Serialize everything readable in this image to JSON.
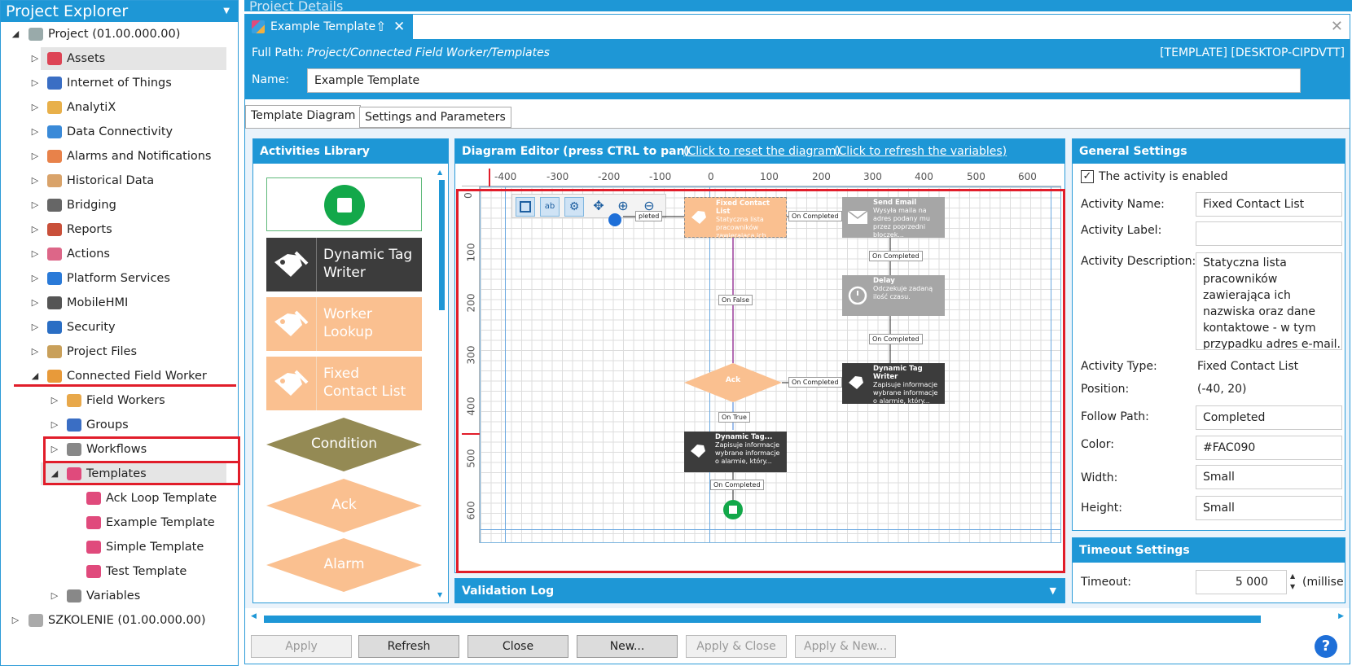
{
  "explorer": {
    "title": "Project Explorer",
    "items": [
      {
        "label": "Project (01.00.000.00)",
        "icon": "project-icon",
        "expanded": true
      },
      {
        "label": "Assets",
        "icon": "assets-icon"
      },
      {
        "label": "Internet of Things",
        "icon": "iot-icon"
      },
      {
        "label": "AnalytiX",
        "icon": "analytix-icon"
      },
      {
        "label": "Data Connectivity",
        "icon": "data-connectivity-icon"
      },
      {
        "label": "Alarms and Notifications",
        "icon": "alarm-icon"
      },
      {
        "label": "Historical Data",
        "icon": "historical-data-icon"
      },
      {
        "label": "Bridging",
        "icon": "bridging-icon"
      },
      {
        "label": "Reports",
        "icon": "reports-icon"
      },
      {
        "label": "Actions",
        "icon": "actions-icon"
      },
      {
        "label": "Platform Services",
        "icon": "platform-services-icon"
      },
      {
        "label": "MobileHMI",
        "icon": "mobilehmi-icon"
      },
      {
        "label": "Security",
        "icon": "security-icon"
      },
      {
        "label": "Project Files",
        "icon": "project-files-icon"
      },
      {
        "label": "Connected Field Worker",
        "icon": "connected-field-worker-icon"
      },
      {
        "label": "Field Workers",
        "icon": "field-workers-icon"
      },
      {
        "label": "Groups",
        "icon": "groups-icon"
      },
      {
        "label": "Workflows",
        "icon": "workflows-icon"
      },
      {
        "label": "Templates",
        "icon": "templates-icon"
      },
      {
        "label": "Ack Loop Template",
        "icon": "template-icon"
      },
      {
        "label": "Example Template",
        "icon": "template-icon"
      },
      {
        "label": "Simple Template",
        "icon": "template-icon"
      },
      {
        "label": "Test Template",
        "icon": "template-icon"
      },
      {
        "label": "Variables",
        "icon": "variables-icon"
      },
      {
        "label": "SZKOLENIE (01.00.000.00)",
        "icon": "project-icon"
      }
    ]
  },
  "details": {
    "panel_title": "Project Details",
    "tab_title": "Example Template",
    "full_path_label": "Full Path:",
    "full_path_value": "Project/Connected Field Worker/Templates",
    "server_tag": "[TEMPLATE] [DESKTOP-CIPDVTT]",
    "name_label": "Name:",
    "name_value": "Example Template",
    "subtabs": [
      "Template Diagram",
      "Settings and Parameters"
    ]
  },
  "library": {
    "title": "Activities Library",
    "items": [
      "Dynamic Tag Writer",
      "Worker Lookup",
      "Fixed Contact List",
      "Condition",
      "Ack",
      "Alarm"
    ]
  },
  "diagram": {
    "title": "Diagram Editor (press CTRL to pan)",
    "reset_link": "(Click to reset the diagram)",
    "refresh_link": "(Click to refresh the variables)",
    "ruler_x": [
      "-400",
      "-300",
      "-200",
      "-100",
      "0",
      "100",
      "200",
      "300",
      "400",
      "500",
      "600"
    ],
    "ruler_y": [
      "0",
      "100",
      "200",
      "300",
      "400",
      "500",
      "600"
    ],
    "nodes": {
      "fixed_contact": {
        "title": "Fixed Contact List",
        "desc": "Statyczna lista pracowników zawierająca ich..."
      },
      "send_email": {
        "title": "Send Email",
        "desc": "Wysyła maila na adres podany mu przez poprzedni bloczek..."
      },
      "delay": {
        "title": "Delay",
        "desc": "Odczekuje zadaną ilość czasu."
      },
      "dtw_right": {
        "title": "Dynamic Tag Writer",
        "desc": "Zapisuje informacje wybrane informacje o alarmie, który..."
      },
      "dtw_bottom": {
        "title": "Dynamic Tag...",
        "desc": "Zapisuje informacje wybrane informacje o alarmie, który..."
      },
      "ack": {
        "title": "Ack"
      }
    },
    "connectors": {
      "c1": "pleted",
      "c2": "On Completed",
      "c3": "On Completed",
      "c4": "On False",
      "c5": "On Completed",
      "c6": "On Completed",
      "c7": "On True",
      "c8": "On Completed"
    }
  },
  "validation": {
    "title": "Validation Log"
  },
  "general": {
    "title": "General Settings",
    "enabled_label": "The activity is enabled",
    "activity_name_label": "Activity Name:",
    "activity_name_value": "Fixed Contact List",
    "activity_label_label": "Activity Label:",
    "activity_label_value": "",
    "activity_desc_label": "Activity Description:",
    "activity_desc_value": "Statyczna lista pracowników zawierająca ich nazwiska oraz dane kontaktowe - w tym przypadku adres e-mail. Przy każdym obiegu pętli bloczek ten udostępnia na swoim",
    "activity_type_label": "Activity Type:",
    "activity_type_value": "Fixed Contact List",
    "position_label": "Position:",
    "position_value": "(-40, 20)",
    "follow_path_label": "Follow Path:",
    "follow_path_value": "Completed",
    "color_label": "Color:",
    "color_value": "#FAC090",
    "width_label": "Width:",
    "width_value": "Small",
    "height_label": "Height:",
    "height_value": "Small"
  },
  "timeout": {
    "title": "Timeout  Settings",
    "timeout_label": "Timeout:",
    "timeout_value": "5 000",
    "unit": "(millise"
  },
  "buttons": {
    "apply": "Apply",
    "refresh": "Refresh",
    "close": "Close",
    "new": "New...",
    "apply_close": "Apply & Close",
    "apply_new": "Apply & New..."
  },
  "colors": {
    "accent": "#1e97d6",
    "orange": "#fac090",
    "dark": "#3c3c3c",
    "gray": "#a6a6a6",
    "olive": "#948a54",
    "highlight": "#e11d2a"
  }
}
